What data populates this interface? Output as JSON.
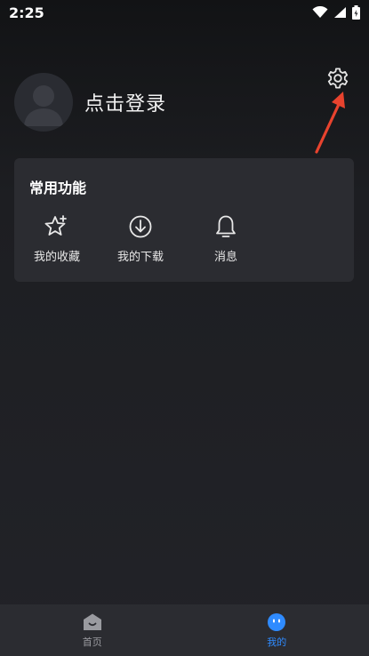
{
  "status_bar": {
    "time": "2:25",
    "icons": [
      "wifi-icon",
      "signal-icon",
      "battery-icon"
    ]
  },
  "profile": {
    "login_label": "点击登录"
  },
  "header": {
    "settings_icon": "gear-icon"
  },
  "common_functions": {
    "title": "常用功能",
    "items": [
      {
        "label": "我的收藏",
        "icon": "star-icon"
      },
      {
        "label": "我的下载",
        "icon": "download-icon"
      },
      {
        "label": "消息",
        "icon": "bell-icon"
      }
    ]
  },
  "bottom_nav": {
    "items": [
      {
        "label": "首页",
        "icon": "home-icon",
        "active": false
      },
      {
        "label": "我的",
        "icon": "profile-face-icon",
        "active": true
      }
    ],
    "active_color": "#2f8bff",
    "inactive_color": "#9a9ba0"
  },
  "colors": {
    "background": "#1d1e22",
    "card": "#2b2c31",
    "annotation_arrow": "#e8432e"
  }
}
